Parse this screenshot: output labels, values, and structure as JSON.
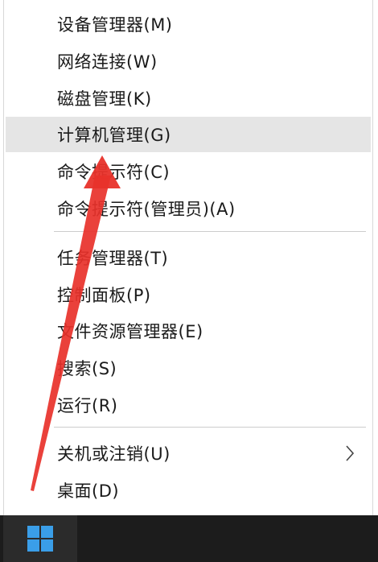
{
  "menu": {
    "items": [
      {
        "label": "设备管理器(M)"
      },
      {
        "label": "网络连接(W)"
      },
      {
        "label": "磁盘管理(K)"
      },
      {
        "label": "计算机管理(G)"
      },
      {
        "label": "命令提示符(C)"
      },
      {
        "label": "命令提示符(管理员)(A)"
      },
      {
        "label": "任务管理器(T)"
      },
      {
        "label": "控制面板(P)"
      },
      {
        "label": "文件资源管理器(E)"
      },
      {
        "label": "搜索(S)"
      },
      {
        "label": "运行(R)"
      },
      {
        "label": "关机或注销(U)"
      },
      {
        "label": "桌面(D)"
      }
    ],
    "highlighted_item": "计算机管理(G)"
  },
  "colors": {
    "hover_bg": "#e5e5e5",
    "taskbar": "#1c1c1c",
    "windows_logo": "#3a9ee8",
    "annotation_arrow": "#e8312a"
  },
  "icons": {
    "submenu": "chevron-right-icon",
    "start": "windows-logo-icon"
  }
}
